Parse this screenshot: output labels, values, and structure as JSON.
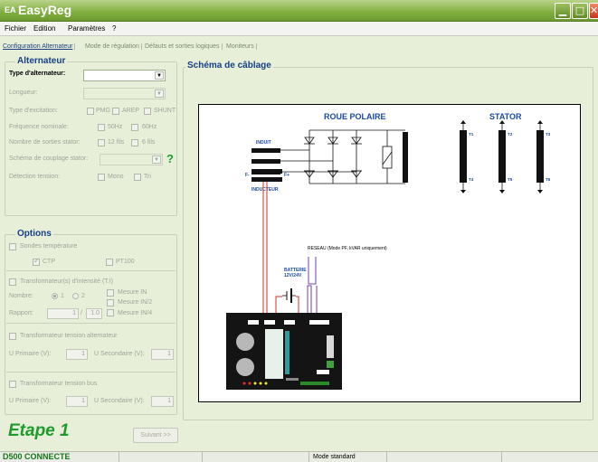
{
  "window": {
    "title": "EasyReg",
    "logo_text": "EA"
  },
  "menu": [
    "Fichier",
    "Edition",
    "Paramètres",
    "?"
  ],
  "tabs": [
    "Configuration Alternateur",
    "Mode de régulation",
    "Défauts et sorties logiques",
    "Moniteurs"
  ],
  "alternateur": {
    "title": "Alternateur",
    "type_label": "Type d'alternateur:",
    "longueur_label": "Longueur:",
    "excitation_label": "Type d'excitation:",
    "excitation_options": [
      "PMG",
      "AREP",
      "SHUNT"
    ],
    "frequence_label": "Fréquence nominale:",
    "frequence_options": [
      "50Hz",
      "60Hz"
    ],
    "sorties_label": "Nombre de sorties stator:",
    "sorties_options": [
      "12 fils",
      "6 fils"
    ],
    "schema_label": "Schéma de couplage stator:",
    "help": "?",
    "detection_label": "Détection tension:",
    "detection_options": [
      "Mono",
      "Tri"
    ]
  },
  "options": {
    "title": "Options",
    "sondes_label": "Sondes température",
    "ctp": "CTP",
    "pt100": "PT100",
    "ti_label": "Transformateur(s) d'intensité (T.I)",
    "nombre_label": "Nombre:",
    "radio1": "1",
    "radio2": "2",
    "mesure_in": "Mesure IN",
    "mesure_in2": "Mesure IN/2",
    "mesure_in4": "Mesure IN/4",
    "rapport_label": "Rapport:",
    "rapport_val1": "1",
    "rapport_sep": "/",
    "rapport_val2": "1.0",
    "tta_label": "Transformateur tension alternateur",
    "u_primaire": "U Primaire (V):",
    "u_primaire_val": "1",
    "u_secondaire": "U Secondaire (V):",
    "u_secondaire_val": "1",
    "ttb_label": "Transformateur tension bus",
    "u_primaire_bus_val": "1",
    "u_secondaire_bus_val": "1"
  },
  "schema": {
    "title": "Schéma de câblage",
    "roue_polaire": "ROUE POLAIRE",
    "stator": "STATOR",
    "induit": "INDUIT",
    "inducteur": "INDUCTEUR",
    "f_minus": "F-",
    "f_plus": "F+",
    "reseau": "RESEAU (Mode PF, kVAR uniquement)",
    "batterie": "BATTERIE",
    "batterie_v": "12V/24V",
    "terminals": [
      "T1",
      "T4",
      "T2",
      "T5",
      "T3",
      "T6"
    ]
  },
  "footer": {
    "step": "Etape 1",
    "next_button": "Suivant >>"
  },
  "status": {
    "connection": "D500 CONNECTE",
    "mode": "Mode standard"
  }
}
